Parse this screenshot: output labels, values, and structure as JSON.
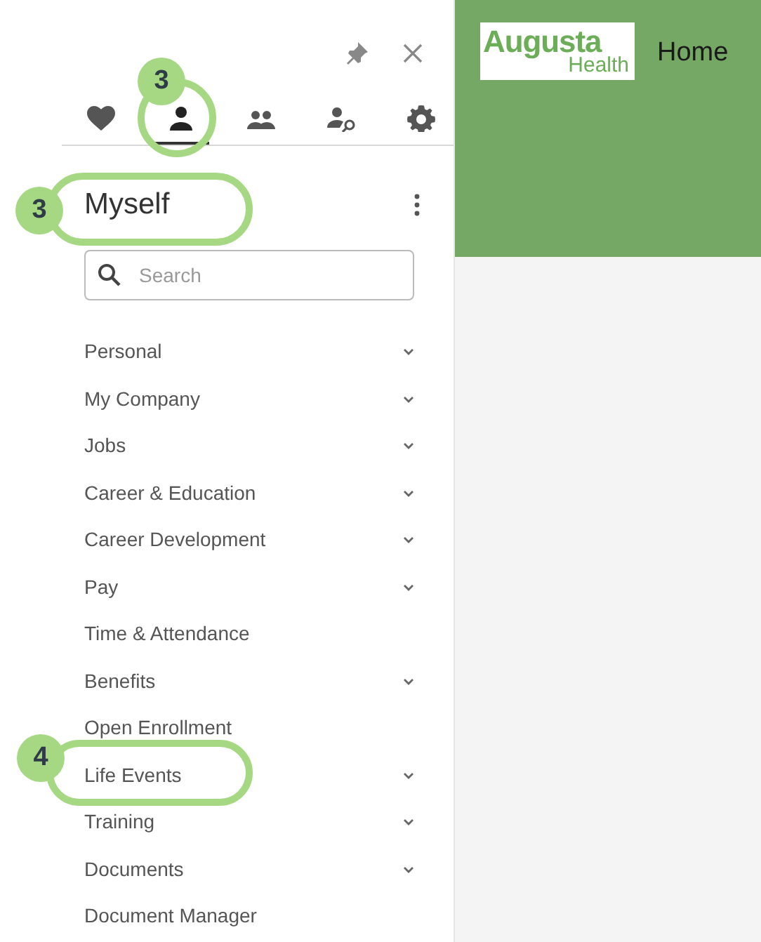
{
  "panel_actions": [
    {
      "kind": "pin"
    },
    {
      "kind": "close"
    }
  ],
  "tabs": [
    {
      "kind": "heart",
      "selected": false
    },
    {
      "kind": "person",
      "selected": true
    },
    {
      "kind": "people",
      "selected": false
    },
    {
      "kind": "person-key",
      "selected": false
    },
    {
      "kind": "gear",
      "selected": false
    }
  ],
  "section_title": "Myself",
  "search": {
    "placeholder": "Search"
  },
  "menu_items": [
    {
      "label": "Personal",
      "expandable": true
    },
    {
      "label": "My Company",
      "expandable": true
    },
    {
      "label": "Jobs",
      "expandable": true
    },
    {
      "label": "Career & Education",
      "expandable": true
    },
    {
      "label": "Career Development",
      "expandable": true
    },
    {
      "label": "Pay",
      "expandable": true
    },
    {
      "label": "Time & Attendance",
      "expandable": false
    },
    {
      "label": "Benefits",
      "expandable": true
    },
    {
      "label": "Open Enrollment",
      "expandable": false
    },
    {
      "label": "Life Events",
      "expandable": true
    },
    {
      "label": "Training",
      "expandable": true
    },
    {
      "label": "Documents",
      "expandable": true
    },
    {
      "label": "Document Manager",
      "expandable": false
    }
  ],
  "header": {
    "logo_top": "Augusta",
    "logo_bottom": "Health",
    "title": "Home"
  },
  "callouts": [
    {
      "number": "3"
    },
    {
      "number": "3"
    },
    {
      "number": "4"
    }
  ]
}
